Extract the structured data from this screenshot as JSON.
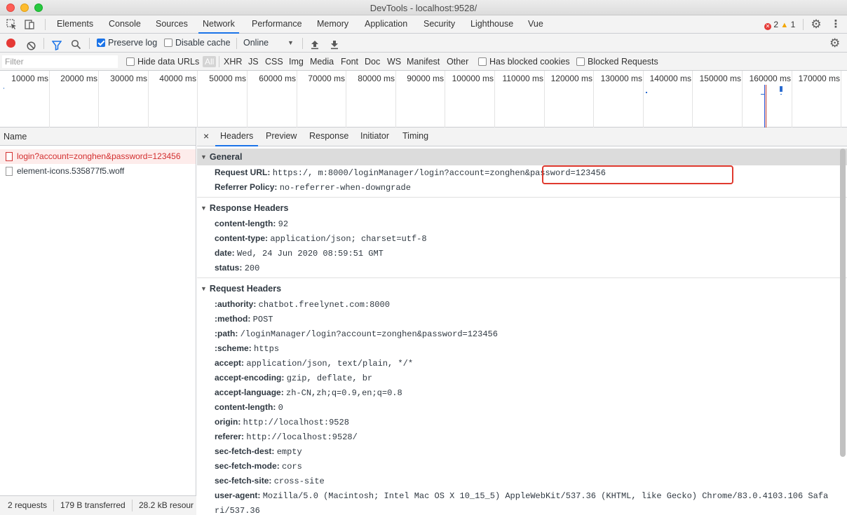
{
  "window": {
    "title": "DevTools - localhost:9528/"
  },
  "main_tabs": [
    "Elements",
    "Console",
    "Sources",
    "Network",
    "Performance",
    "Memory",
    "Application",
    "Security",
    "Lighthouse",
    "Vue"
  ],
  "active_main_tab": "Network",
  "badges": {
    "errors": "2",
    "warnings": "1"
  },
  "toolbar": {
    "preserve_log": "Preserve log",
    "disable_cache": "Disable cache",
    "throttle": "Online"
  },
  "filterbar": {
    "placeholder": "Filter",
    "hide_data_urls": "Hide data URLs",
    "types": [
      "All",
      "XHR",
      "JS",
      "CSS",
      "Img",
      "Media",
      "Font",
      "Doc",
      "WS",
      "Manifest",
      "Other"
    ],
    "has_blocked_cookies": "Has blocked cookies",
    "blocked_requests": "Blocked Requests"
  },
  "timeline": {
    "ticks": [
      "10000 ms",
      "20000 ms",
      "30000 ms",
      "40000 ms",
      "50000 ms",
      "60000 ms",
      "70000 ms",
      "80000 ms",
      "90000 ms",
      "100000 ms",
      "110000 ms",
      "120000 ms",
      "130000 ms",
      "140000 ms",
      "150000 ms",
      "160000 ms",
      "170000 ms"
    ]
  },
  "list": {
    "header": "Name",
    "requests": [
      "login?account=zonghen&password=123456",
      "element-icons.535877f5.woff"
    ],
    "status": {
      "requests": "2 requests",
      "transferred": "179 B transferred",
      "resources": "28.2 kB resour"
    }
  },
  "detail": {
    "close": "×",
    "tabs": [
      "Headers",
      "Preview",
      "Response",
      "Initiator",
      "Timing"
    ],
    "general": {
      "title": "General",
      "rows": [
        {
          "k": "Request URL:",
          "v": "https:/,                    m:8000/loginManager/login?account=zonghen&password=123456"
        },
        {
          "k": "Referrer Policy:",
          "v": "no-referrer-when-downgrade"
        }
      ]
    },
    "response_headers": {
      "title": "Response Headers",
      "rows": [
        {
          "k": "content-length:",
          "v": "92"
        },
        {
          "k": "content-type:",
          "v": "application/json; charset=utf-8"
        },
        {
          "k": "date:",
          "v": "Wed, 24 Jun 2020 08:59:51 GMT"
        },
        {
          "k": "status:",
          "v": "200"
        }
      ]
    },
    "request_headers": {
      "title": "Request Headers",
      "rows": [
        {
          "k": ":authority:",
          "v": "chatbot.freelynet.com:8000"
        },
        {
          "k": ":method:",
          "v": "POST"
        },
        {
          "k": ":path:",
          "v": "/loginManager/login?account=zonghen&password=123456"
        },
        {
          "k": ":scheme:",
          "v": "https"
        },
        {
          "k": "accept:",
          "v": "application/json, text/plain, */*"
        },
        {
          "k": "accept-encoding:",
          "v": "gzip, deflate, br"
        },
        {
          "k": "accept-language:",
          "v": "zh-CN,zh;q=0.9,en;q=0.8"
        },
        {
          "k": "content-length:",
          "v": "0"
        },
        {
          "k": "origin:",
          "v": "http://localhost:9528"
        },
        {
          "k": "referer:",
          "v": "http://localhost:9528/"
        },
        {
          "k": "sec-fetch-dest:",
          "v": "empty"
        },
        {
          "k": "sec-fetch-mode:",
          "v": "cors"
        },
        {
          "k": "sec-fetch-site:",
          "v": "cross-site"
        },
        {
          "k": "user-agent:",
          "v": "Mozilla/5.0 (Macintosh; Intel Mac OS X 10_15_5) AppleWebKit/537.36 (KHTML, like Gecko) Chrome/83.0.4103.106 Safa"
        },
        {
          "k": "",
          "v": "ri/537.36"
        }
      ]
    }
  }
}
